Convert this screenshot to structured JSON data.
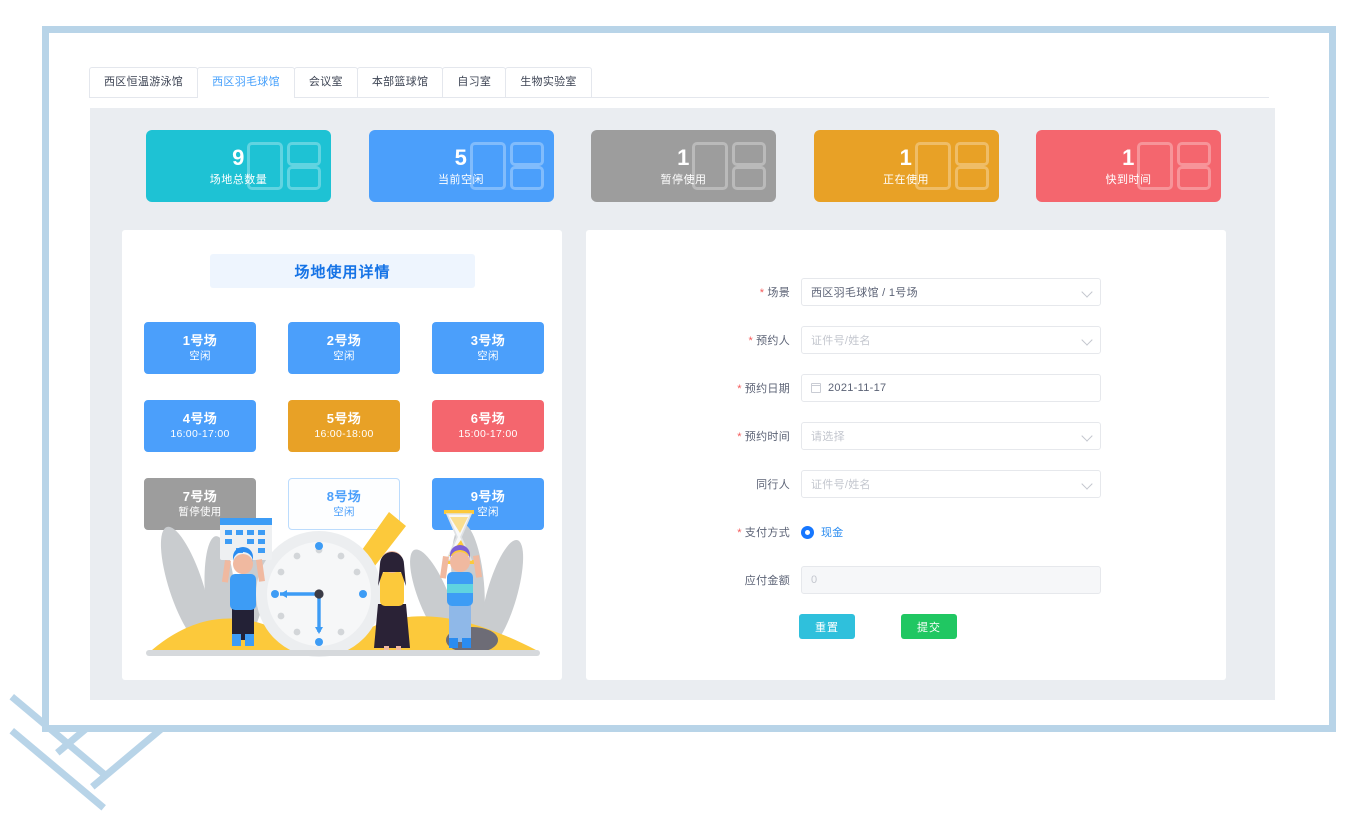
{
  "tabs": [
    {
      "label": "西区恒温游泳馆",
      "active": false
    },
    {
      "label": "西区羽毛球馆",
      "active": true
    },
    {
      "label": "会议室",
      "active": false
    },
    {
      "label": "本部篮球馆",
      "active": false
    },
    {
      "label": "自习室",
      "active": false
    },
    {
      "label": "生物实验室",
      "active": false
    }
  ],
  "stats": [
    {
      "value": "9",
      "label": "场地总数量",
      "color": "#1ec2d4"
    },
    {
      "value": "5",
      "label": "当前空闲",
      "color": "#4b9ffb"
    },
    {
      "value": "1",
      "label": "暂停使用",
      "color": "#9d9d9d"
    },
    {
      "value": "1",
      "label": "正在使用",
      "color": "#e8a126"
    },
    {
      "value": "1",
      "label": "快到时间",
      "color": "#f4666e"
    }
  ],
  "detail": {
    "title": "场地使用详情",
    "courts": [
      {
        "name": "1号场",
        "status": "空闲",
        "state": "free"
      },
      {
        "name": "2号场",
        "status": "空闲",
        "state": "free"
      },
      {
        "name": "3号场",
        "status": "空闲",
        "state": "free"
      },
      {
        "name": "4号场",
        "status": "16:00-17:00",
        "state": "free"
      },
      {
        "name": "5号场",
        "status": "16:00-18:00",
        "state": "using"
      },
      {
        "name": "6号场",
        "status": "15:00-17:00",
        "state": "ending"
      },
      {
        "name": "7号场",
        "status": "暂停使用",
        "state": "paused"
      },
      {
        "name": "8号场",
        "status": "空闲",
        "state": "selected"
      },
      {
        "name": "9号场",
        "status": "空闲",
        "state": "free"
      }
    ]
  },
  "form": {
    "venue": {
      "label": "场景",
      "value": "西区羽毛球馆 / 1号场"
    },
    "booker": {
      "label": "预约人",
      "placeholder": "证件号/姓名"
    },
    "date": {
      "label": "预约日期",
      "value": "2021-11-17"
    },
    "time": {
      "label": "预约时间",
      "placeholder": "请选择"
    },
    "companion": {
      "label": "同行人",
      "placeholder": "证件号/姓名"
    },
    "payment": {
      "label": "支付方式",
      "option": "现金"
    },
    "amount": {
      "label": "应付金额",
      "placeholder": "0"
    },
    "reset_label": "重置",
    "submit_label": "提交"
  }
}
